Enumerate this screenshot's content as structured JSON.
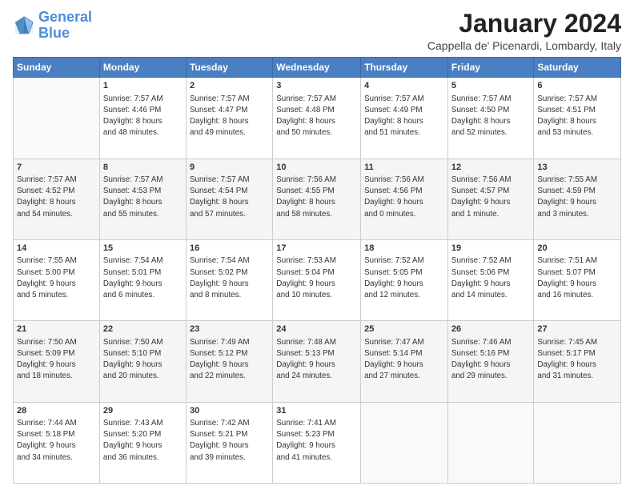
{
  "logo": {
    "line1": "General",
    "line2": "Blue"
  },
  "title": "January 2024",
  "location": "Cappella de' Picenardi, Lombardy, Italy",
  "days_of_week": [
    "Sunday",
    "Monday",
    "Tuesday",
    "Wednesday",
    "Thursday",
    "Friday",
    "Saturday"
  ],
  "weeks": [
    [
      {
        "day": "",
        "info": ""
      },
      {
        "day": "1",
        "info": "Sunrise: 7:57 AM\nSunset: 4:46 PM\nDaylight: 8 hours\nand 48 minutes."
      },
      {
        "day": "2",
        "info": "Sunrise: 7:57 AM\nSunset: 4:47 PM\nDaylight: 8 hours\nand 49 minutes."
      },
      {
        "day": "3",
        "info": "Sunrise: 7:57 AM\nSunset: 4:48 PM\nDaylight: 8 hours\nand 50 minutes."
      },
      {
        "day": "4",
        "info": "Sunrise: 7:57 AM\nSunset: 4:49 PM\nDaylight: 8 hours\nand 51 minutes."
      },
      {
        "day": "5",
        "info": "Sunrise: 7:57 AM\nSunset: 4:50 PM\nDaylight: 8 hours\nand 52 minutes."
      },
      {
        "day": "6",
        "info": "Sunrise: 7:57 AM\nSunset: 4:51 PM\nDaylight: 8 hours\nand 53 minutes."
      }
    ],
    [
      {
        "day": "7",
        "info": "Sunrise: 7:57 AM\nSunset: 4:52 PM\nDaylight: 8 hours\nand 54 minutes."
      },
      {
        "day": "8",
        "info": "Sunrise: 7:57 AM\nSunset: 4:53 PM\nDaylight: 8 hours\nand 55 minutes."
      },
      {
        "day": "9",
        "info": "Sunrise: 7:57 AM\nSunset: 4:54 PM\nDaylight: 8 hours\nand 57 minutes."
      },
      {
        "day": "10",
        "info": "Sunrise: 7:56 AM\nSunset: 4:55 PM\nDaylight: 8 hours\nand 58 minutes."
      },
      {
        "day": "11",
        "info": "Sunrise: 7:56 AM\nSunset: 4:56 PM\nDaylight: 9 hours\nand 0 minutes."
      },
      {
        "day": "12",
        "info": "Sunrise: 7:56 AM\nSunset: 4:57 PM\nDaylight: 9 hours\nand 1 minute."
      },
      {
        "day": "13",
        "info": "Sunrise: 7:55 AM\nSunset: 4:59 PM\nDaylight: 9 hours\nand 3 minutes."
      }
    ],
    [
      {
        "day": "14",
        "info": "Sunrise: 7:55 AM\nSunset: 5:00 PM\nDaylight: 9 hours\nand 5 minutes."
      },
      {
        "day": "15",
        "info": "Sunrise: 7:54 AM\nSunset: 5:01 PM\nDaylight: 9 hours\nand 6 minutes."
      },
      {
        "day": "16",
        "info": "Sunrise: 7:54 AM\nSunset: 5:02 PM\nDaylight: 9 hours\nand 8 minutes."
      },
      {
        "day": "17",
        "info": "Sunrise: 7:53 AM\nSunset: 5:04 PM\nDaylight: 9 hours\nand 10 minutes."
      },
      {
        "day": "18",
        "info": "Sunrise: 7:52 AM\nSunset: 5:05 PM\nDaylight: 9 hours\nand 12 minutes."
      },
      {
        "day": "19",
        "info": "Sunrise: 7:52 AM\nSunset: 5:06 PM\nDaylight: 9 hours\nand 14 minutes."
      },
      {
        "day": "20",
        "info": "Sunrise: 7:51 AM\nSunset: 5:07 PM\nDaylight: 9 hours\nand 16 minutes."
      }
    ],
    [
      {
        "day": "21",
        "info": "Sunrise: 7:50 AM\nSunset: 5:09 PM\nDaylight: 9 hours\nand 18 minutes."
      },
      {
        "day": "22",
        "info": "Sunrise: 7:50 AM\nSunset: 5:10 PM\nDaylight: 9 hours\nand 20 minutes."
      },
      {
        "day": "23",
        "info": "Sunrise: 7:49 AM\nSunset: 5:12 PM\nDaylight: 9 hours\nand 22 minutes."
      },
      {
        "day": "24",
        "info": "Sunrise: 7:48 AM\nSunset: 5:13 PM\nDaylight: 9 hours\nand 24 minutes."
      },
      {
        "day": "25",
        "info": "Sunrise: 7:47 AM\nSunset: 5:14 PM\nDaylight: 9 hours\nand 27 minutes."
      },
      {
        "day": "26",
        "info": "Sunrise: 7:46 AM\nSunset: 5:16 PM\nDaylight: 9 hours\nand 29 minutes."
      },
      {
        "day": "27",
        "info": "Sunrise: 7:45 AM\nSunset: 5:17 PM\nDaylight: 9 hours\nand 31 minutes."
      }
    ],
    [
      {
        "day": "28",
        "info": "Sunrise: 7:44 AM\nSunset: 5:18 PM\nDaylight: 9 hours\nand 34 minutes."
      },
      {
        "day": "29",
        "info": "Sunrise: 7:43 AM\nSunset: 5:20 PM\nDaylight: 9 hours\nand 36 minutes."
      },
      {
        "day": "30",
        "info": "Sunrise: 7:42 AM\nSunset: 5:21 PM\nDaylight: 9 hours\nand 39 minutes."
      },
      {
        "day": "31",
        "info": "Sunrise: 7:41 AM\nSunset: 5:23 PM\nDaylight: 9 hours\nand 41 minutes."
      },
      {
        "day": "",
        "info": ""
      },
      {
        "day": "",
        "info": ""
      },
      {
        "day": "",
        "info": ""
      }
    ]
  ]
}
